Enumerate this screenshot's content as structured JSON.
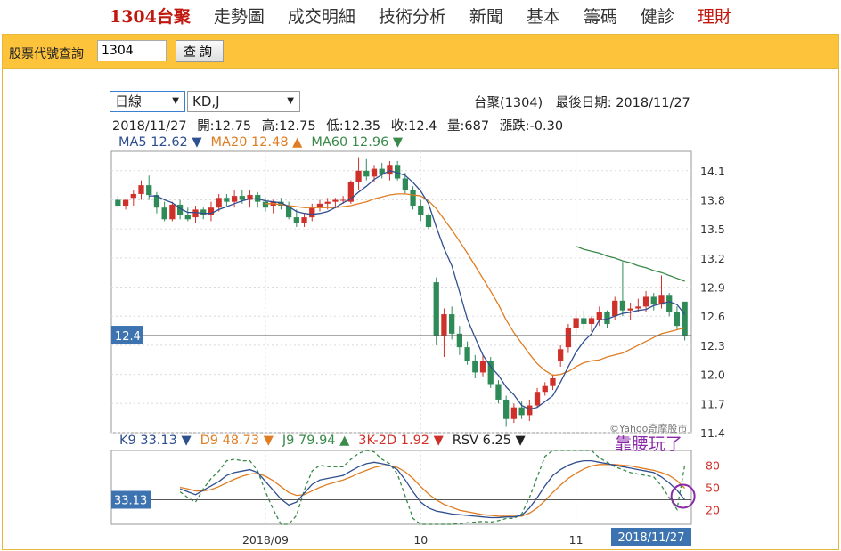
{
  "nav": {
    "items": [
      {
        "label": "1304台聚",
        "style": "active"
      },
      {
        "label": "走勢圖",
        "style": ""
      },
      {
        "label": "成交明細",
        "style": ""
      },
      {
        "label": "技術分析",
        "style": ""
      },
      {
        "label": "新聞",
        "style": ""
      },
      {
        "label": "基本",
        "style": ""
      },
      {
        "label": "籌碼",
        "style": ""
      },
      {
        "label": "健診",
        "style": ""
      },
      {
        "label": "理財",
        "style": "red"
      }
    ]
  },
  "query": {
    "label": "股票代號查詢",
    "value": "1304",
    "button": "查詢"
  },
  "controls": {
    "period": "日線",
    "indicator": "KD,J"
  },
  "stock": {
    "info": "台聚(1304)　最後日期: 2018/11/27",
    "date": "2018/11/27",
    "open": "開:12.75",
    "high": "高:12.75",
    "low": "低:12.35",
    "close": "收:12.4",
    "volume": "量:687",
    "change": "漲跌:-0.30"
  },
  "ma_legend": [
    {
      "label": "MA5 12.62 ▼",
      "color": "#2f4f8f"
    },
    {
      "label": "MA20 12.48 ▲",
      "color": "#e07d22"
    },
    {
      "label": "MA60 12.96 ▼",
      "color": "#3a8a4a"
    }
  ],
  "kd_legend": [
    {
      "label": "K9 33.13 ▼",
      "color": "#2f4f8f"
    },
    {
      "label": "D9 48.73 ▼",
      "color": "#e07d22"
    },
    {
      "label": "J9 79.94 ▲",
      "color": "#3a8a4a"
    },
    {
      "label": "3K-2D 1.92 ▼",
      "color": "#d0302a"
    },
    {
      "label": "RSV 6.25 ▼",
      "color": "#222222"
    }
  ],
  "callout": "靠腰玩了",
  "watermark": "©Yahoo奇摩股市",
  "colors": {
    "up": "#d0302a",
    "down": "#2e8b57",
    "ma5": "#2f4f8f",
    "ma20": "#e07d22",
    "ma60": "#3a8a4a",
    "k": "#2f4f8f",
    "d": "#e07d22",
    "j": "#3a8a4a",
    "label_bg": "#3c73b0",
    "callout": "#8a2aa8"
  },
  "chart_data": {
    "type": "candlestick",
    "price_axis": {
      "ylim": [
        11.4,
        14.3
      ],
      "ticks": [
        "14.1",
        "13.8",
        "13.5",
        "13.2",
        "12.9",
        "12.6",
        "12.3",
        "12.0",
        "11.7",
        "11.4"
      ],
      "tick_values": [
        14.1,
        13.8,
        13.5,
        13.2,
        12.9,
        12.6,
        12.3,
        12.0,
        11.7,
        11.4
      ]
    },
    "current_price_label": "12.4",
    "current_price": 12.4,
    "kd_axis": {
      "ylim": [
        0,
        100
      ],
      "ticks": [
        "80",
        "50",
        "20"
      ],
      "tick_values": [
        80,
        50,
        20
      ]
    },
    "current_k_label": "33.13",
    "current_k": 33.13,
    "x_axis": {
      "labels": [
        "2018/09",
        "10",
        "11"
      ],
      "label_index": [
        19,
        39,
        59
      ],
      "last_label": "2018/11/27"
    },
    "candles": [
      [
        13.8,
        13.84,
        13.72,
        13.74
      ],
      [
        13.74,
        13.8,
        13.7,
        13.8
      ],
      [
        13.82,
        13.9,
        13.74,
        13.86
      ],
      [
        13.86,
        14.0,
        13.8,
        13.95
      ],
      [
        13.95,
        14.05,
        13.8,
        13.85
      ],
      [
        13.85,
        13.88,
        13.66,
        13.72
      ],
      [
        13.72,
        13.78,
        13.58,
        13.6
      ],
      [
        13.6,
        13.78,
        13.58,
        13.75
      ],
      [
        13.75,
        13.8,
        13.6,
        13.64
      ],
      [
        13.64,
        13.72,
        13.58,
        13.6
      ],
      [
        13.62,
        13.74,
        13.56,
        13.7
      ],
      [
        13.7,
        13.72,
        13.6,
        13.64
      ],
      [
        13.64,
        13.78,
        13.58,
        13.72
      ],
      [
        13.72,
        13.86,
        13.68,
        13.82
      ],
      [
        13.82,
        13.86,
        13.74,
        13.78
      ],
      [
        13.78,
        13.9,
        13.72,
        13.84
      ],
      [
        13.84,
        13.9,
        13.76,
        13.8
      ],
      [
        13.8,
        13.9,
        13.72,
        13.85
      ],
      [
        13.85,
        13.88,
        13.72,
        13.78
      ],
      [
        13.78,
        13.82,
        13.68,
        13.72
      ],
      [
        13.74,
        13.8,
        13.66,
        13.78
      ],
      [
        13.78,
        13.82,
        13.7,
        13.74
      ],
      [
        13.74,
        13.78,
        13.6,
        13.62
      ],
      [
        13.62,
        13.7,
        13.52,
        13.56
      ],
      [
        13.56,
        13.66,
        13.52,
        13.62
      ],
      [
        13.62,
        13.76,
        13.58,
        13.72
      ],
      [
        13.72,
        13.8,
        13.68,
        13.76
      ],
      [
        13.76,
        13.82,
        13.7,
        13.78
      ],
      [
        13.78,
        13.82,
        13.72,
        13.8
      ],
      [
        13.8,
        13.84,
        13.76,
        13.8
      ],
      [
        13.78,
        14.0,
        13.76,
        13.98
      ],
      [
        13.98,
        14.24,
        13.9,
        14.1
      ],
      [
        14.1,
        14.22,
        14.0,
        14.04
      ],
      [
        14.04,
        14.16,
        13.98,
        14.12
      ],
      [
        14.12,
        14.18,
        14.02,
        14.06
      ],
      [
        14.06,
        14.2,
        14.0,
        14.16
      ],
      [
        14.16,
        14.2,
        14.0,
        14.02
      ],
      [
        14.02,
        14.08,
        13.86,
        13.9
      ],
      [
        13.9,
        13.94,
        13.7,
        13.74
      ],
      [
        13.74,
        13.8,
        13.58,
        13.64
      ],
      [
        13.64,
        13.66,
        13.5,
        13.52
      ],
      [
        12.95,
        13.0,
        12.3,
        12.4
      ],
      [
        12.4,
        12.68,
        12.18,
        12.62
      ],
      [
        12.62,
        12.7,
        12.36,
        12.42
      ],
      [
        12.42,
        12.5,
        12.2,
        12.28
      ],
      [
        12.28,
        12.34,
        12.1,
        12.14
      ],
      [
        12.14,
        12.2,
        11.96,
        12.02
      ],
      [
        12.02,
        12.2,
        11.98,
        12.14
      ],
      [
        12.14,
        12.18,
        11.86,
        11.9
      ],
      [
        11.9,
        11.94,
        11.7,
        11.74
      ],
      [
        11.74,
        11.78,
        11.46,
        11.54
      ],
      [
        11.54,
        11.7,
        11.5,
        11.66
      ],
      [
        11.66,
        11.72,
        11.54,
        11.58
      ],
      [
        11.58,
        11.74,
        11.52,
        11.68
      ],
      [
        11.68,
        11.86,
        11.66,
        11.82
      ],
      [
        11.82,
        11.92,
        11.78,
        11.88
      ],
      [
        11.88,
        12.0,
        11.84,
        11.96
      ],
      [
        12.14,
        12.3,
        12.08,
        12.26
      ],
      [
        12.28,
        12.52,
        12.22,
        12.48
      ],
      [
        12.48,
        12.66,
        12.42,
        12.58
      ],
      [
        12.58,
        12.66,
        12.46,
        12.52
      ],
      [
        12.52,
        12.6,
        12.44,
        12.58
      ],
      [
        12.56,
        12.7,
        12.5,
        12.64
      ],
      [
        12.64,
        12.66,
        12.48,
        12.52
      ],
      [
        12.6,
        12.8,
        12.56,
        12.76
      ],
      [
        12.76,
        13.16,
        12.6,
        12.66
      ],
      [
        12.66,
        12.74,
        12.56,
        12.68
      ],
      [
        12.68,
        12.78,
        12.64,
        12.7
      ],
      [
        12.7,
        12.86,
        12.64,
        12.8
      ],
      [
        12.8,
        12.84,
        12.66,
        12.72
      ],
      [
        12.72,
        13.02,
        12.68,
        12.82
      ],
      [
        12.82,
        12.84,
        12.6,
        12.64
      ],
      [
        12.64,
        12.7,
        12.46,
        12.5
      ],
      [
        12.75,
        12.75,
        12.35,
        12.4
      ]
    ],
    "ma5": [
      null,
      null,
      null,
      null,
      13.84,
      13.84,
      13.8,
      13.77,
      13.71,
      13.67,
      13.67,
      13.66,
      13.66,
      13.7,
      13.73,
      13.76,
      13.79,
      13.81,
      13.81,
      13.79,
      13.78,
      13.77,
      13.73,
      13.68,
      13.66,
      13.65,
      13.66,
      13.68,
      13.72,
      13.77,
      13.81,
      13.88,
      13.94,
      14.01,
      14.06,
      14.1,
      14.08,
      14.05,
      13.98,
      13.89,
      13.76,
      13.52,
      13.3,
      13.12,
      12.85,
      12.57,
      12.38,
      12.2,
      12.08,
      11.99,
      11.87,
      11.79,
      11.68,
      11.64,
      11.66,
      11.72,
      11.78,
      11.92,
      12.08,
      12.23,
      12.34,
      12.42,
      12.56,
      12.57,
      12.6,
      12.63,
      12.64,
      12.66,
      12.67,
      12.71,
      12.73,
      12.75,
      12.72,
      12.62
    ],
    "ma20": [
      null,
      null,
      null,
      null,
      null,
      null,
      null,
      null,
      null,
      null,
      null,
      null,
      null,
      null,
      null,
      null,
      null,
      null,
      null,
      13.76,
      13.76,
      13.75,
      13.74,
      13.73,
      13.72,
      13.72,
      13.72,
      13.72,
      13.72,
      13.73,
      13.74,
      13.76,
      13.78,
      13.81,
      13.83,
      13.85,
      13.86,
      13.86,
      13.85,
      13.84,
      13.79,
      13.71,
      13.6,
      13.49,
      13.37,
      13.25,
      13.12,
      12.99,
      12.86,
      12.72,
      12.56,
      12.43,
      12.32,
      12.21,
      12.11,
      12.04,
      11.99,
      12.0,
      12.03,
      12.08,
      12.12,
      12.14,
      12.15,
      12.18,
      12.2,
      12.22,
      12.26,
      12.3,
      12.34,
      12.38,
      12.42,
      12.44,
      12.46,
      12.48
    ],
    "ma60": [
      null,
      null,
      null,
      null,
      null,
      null,
      null,
      null,
      null,
      null,
      null,
      null,
      null,
      null,
      null,
      null,
      null,
      null,
      null,
      null,
      null,
      null,
      null,
      null,
      null,
      null,
      null,
      null,
      null,
      null,
      null,
      null,
      null,
      null,
      null,
      null,
      null,
      null,
      null,
      null,
      null,
      null,
      null,
      null,
      null,
      null,
      null,
      null,
      null,
      null,
      null,
      null,
      null,
      null,
      null,
      null,
      null,
      null,
      null,
      13.32,
      13.29,
      13.27,
      13.25,
      13.22,
      13.2,
      13.17,
      13.15,
      13.12,
      13.1,
      13.07,
      13.05,
      13.02,
      12.99,
      12.96
    ],
    "k": [
      null,
      null,
      null,
      null,
      null,
      null,
      null,
      null,
      48,
      44,
      40,
      46,
      52,
      58,
      66,
      70,
      72,
      74,
      70,
      58,
      46,
      34,
      26,
      30,
      42,
      54,
      60,
      62,
      64,
      66,
      72,
      78,
      82,
      84,
      82,
      80,
      74,
      60,
      44,
      30,
      22,
      18,
      16,
      14,
      13,
      12,
      11,
      10,
      9,
      9,
      10,
      10,
      12,
      22,
      36,
      52,
      66,
      74,
      80,
      84,
      86,
      86,
      84,
      82,
      80,
      78,
      76,
      74,
      72,
      70,
      64,
      56,
      46,
      33.13
    ],
    "d": [
      null,
      null,
      null,
      null,
      null,
      null,
      null,
      null,
      50,
      48,
      45,
      45,
      47,
      51,
      56,
      61,
      65,
      68,
      69,
      65,
      59,
      51,
      43,
      39,
      40,
      45,
      50,
      54,
      57,
      60,
      64,
      69,
      73,
      77,
      79,
      79,
      77,
      71,
      62,
      51,
      41,
      33,
      27,
      23,
      19,
      17,
      15,
      13,
      12,
      11,
      11,
      11,
      11,
      15,
      22,
      32,
      43,
      53,
      62,
      69,
      75,
      79,
      81,
      81,
      81,
      80,
      79,
      77,
      75,
      73,
      70,
      66,
      59,
      48.73
    ],
    "j": [
      null,
      null,
      null,
      null,
      null,
      null,
      null,
      null,
      44,
      36,
      30,
      48,
      62,
      72,
      86,
      88,
      86,
      86,
      72,
      44,
      20,
      0,
      0,
      12,
      46,
      72,
      80,
      78,
      78,
      78,
      88,
      96,
      100,
      98,
      88,
      82,
      68,
      38,
      8,
      0,
      0,
      0,
      0,
      0,
      1,
      2,
      3,
      4,
      3,
      5,
      8,
      8,
      14,
      36,
      64,
      92,
      100,
      100,
      100,
      100,
      100,
      100,
      90,
      84,
      78,
      74,
      70,
      68,
      66,
      64,
      52,
      36,
      20,
      79.94
    ]
  }
}
